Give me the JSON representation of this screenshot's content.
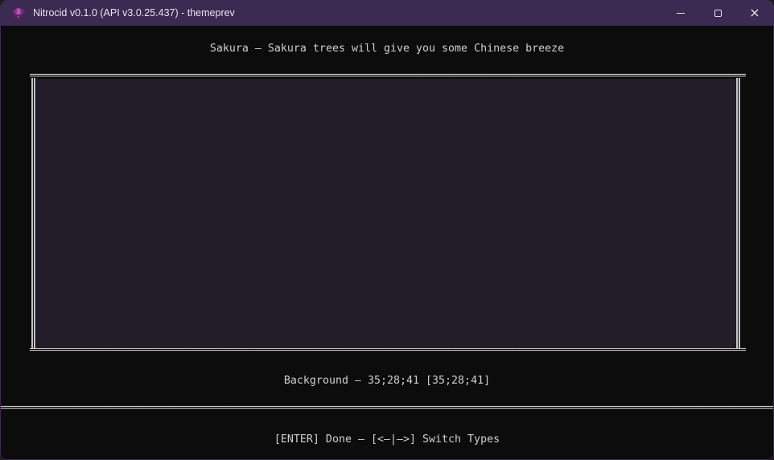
{
  "window": {
    "title": "Nitrocid v0.1.0 (API v3.0.25.437) - themeprev",
    "close_glyph": "×"
  },
  "terminal": {
    "header": "Sakura — Sakura trees will give you some Chinese breeze",
    "background_label": "Background — 35;28;41 [35;28;41]",
    "footer": "[ENTER] Done — [<—|—>] Switch Types"
  },
  "chars": {
    "double_h": "═"
  },
  "colors": {
    "titlebar_bg": "#3B2A52",
    "terminal_bg": "#0C0C0C",
    "preview_background": "#231C29",
    "preview_background_rgb": "35;28;41",
    "line_gray": "#C4C4C4"
  }
}
